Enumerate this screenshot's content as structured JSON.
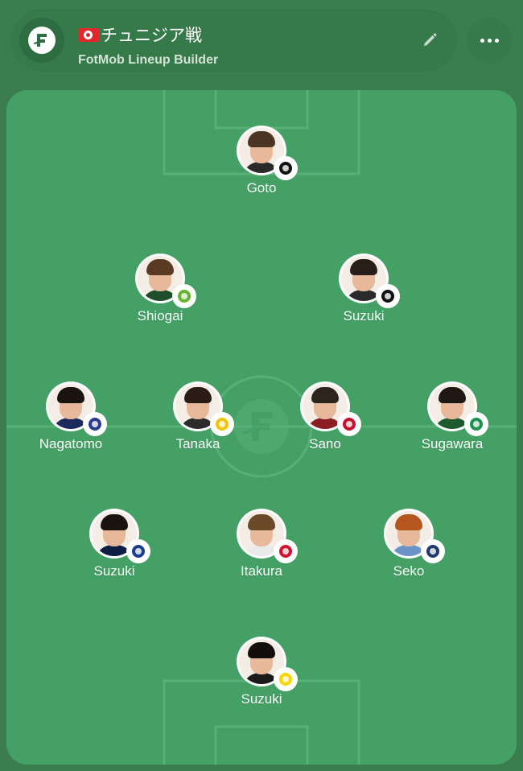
{
  "header": {
    "title": "チュニジア戦",
    "subtitle": "FotMob Lineup Builder",
    "edit_icon": "pencil-icon",
    "more_icon": "more-horizontal-icon",
    "logo_icon": "fotmob-logo-icon",
    "flag_icon": "tunisia-flag-icon"
  },
  "colors": {
    "background": "#3b7d4e",
    "pitch": "#44a065",
    "pitch_lines": "#5bb27a",
    "header": "#367a4a"
  },
  "players": [
    {
      "name": "Goto",
      "club_badge": "freiburg-badge-icon",
      "shirt": "#2a2a2a",
      "hair": "#4a3424",
      "badge_color": "#111111"
    },
    {
      "name": "Shiogai",
      "club_badge": "wolfsburg-badge-icon",
      "shirt": "#1f4f2a",
      "hair": "#5a3a22",
      "badge_color": "#65b32e"
    },
    {
      "name": "Suzuki",
      "club_badge": "freiburg-badge-icon",
      "shirt": "#2a2a2a",
      "hair": "#2a1e18",
      "badge_color": "#111111"
    },
    {
      "name": "Nagatomo",
      "club_badge": "fc-tokyo-badge-icon",
      "shirt": "#1d2a5c",
      "hair": "#1a1410",
      "badge_color": "#2a3c8f"
    },
    {
      "name": "Tanaka",
      "club_badge": "leeds-badge-icon",
      "shirt": "#2b2b2b",
      "hair": "#2a1c14",
      "badge_color": "#f5c400"
    },
    {
      "name": "Sano",
      "club_badge": "mainz-badge-icon",
      "shirt": "#8b1e22",
      "hair": "#2e241e",
      "badge_color": "#c8102e"
    },
    {
      "name": "Sugawara",
      "club_badge": "werder-bremen-badge-icon",
      "shirt": "#1e5a2e",
      "hair": "#1e1812",
      "badge_color": "#1d9053"
    },
    {
      "name": "Suzuki",
      "club_badge": "copenhagen-badge-icon",
      "shirt": "#0e1d44",
      "hair": "#1a1410",
      "badge_color": "#1b3f8f"
    },
    {
      "name": "Itakura",
      "club_badge": "ajax-badge-icon",
      "shirt": "#e9e9e9",
      "hair": "#6b4a2a",
      "badge_color": "#d2122e"
    },
    {
      "name": "Seko",
      "club_badge": "le-havre-badge-icon",
      "shirt": "#6a93c9",
      "hair": "#b5561e",
      "badge_color": "#1f3a6b"
    },
    {
      "name": "Suzuki",
      "club_badge": "parma-badge-icon",
      "shirt": "#1a1a1a",
      "hair": "#120e0c",
      "badge_color": "#ffd400"
    }
  ]
}
